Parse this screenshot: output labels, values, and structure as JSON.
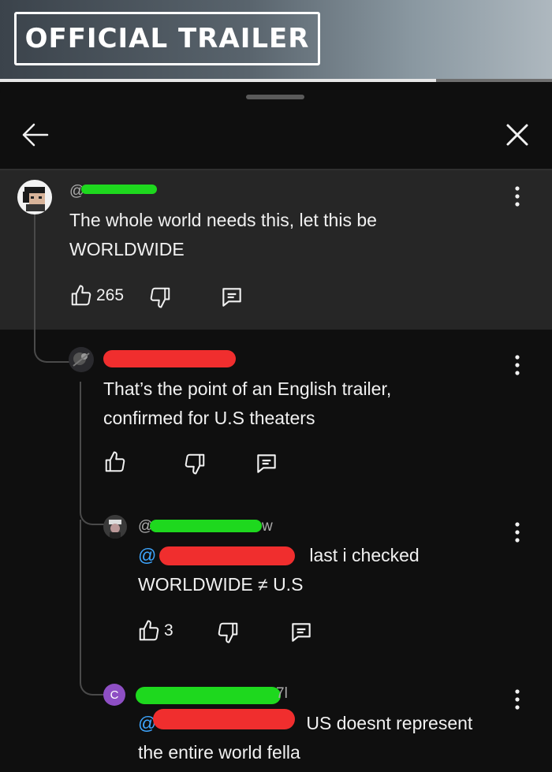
{
  "video": {
    "badge": "OFFICIAL TRAILER",
    "progress": 0.79
  },
  "header": {
    "back_icon": "arrow-left-icon",
    "close_icon": "close-icon"
  },
  "comments": [
    {
      "handle_visible": "@",
      "text_line1": "The whole world needs this, let this be",
      "text_line2": "WORLDWIDE",
      "likes": "265"
    },
    {
      "text_line1": "That’s the point of an English trailer,",
      "text_line2": "confirmed for U.S theaters"
    },
    {
      "handle_visible": "@",
      "handle_tail": "w",
      "mention_prefix": "@",
      "text_line1": "last i checked",
      "text_line2": "WORLDWIDE ≠ U.S",
      "likes": "3"
    },
    {
      "avatar_letter": "C",
      "handle_tail": "7l",
      "mention_prefix": "@",
      "text_line1": "US doesnt represent",
      "text_line2": "the entire world fella"
    }
  ],
  "colors": {
    "background": "#0f0f0f",
    "highlight": "#262626",
    "redact_green": "#1ed81e",
    "redact_red": "#f02e2e",
    "mention": "#3ea6ff"
  }
}
